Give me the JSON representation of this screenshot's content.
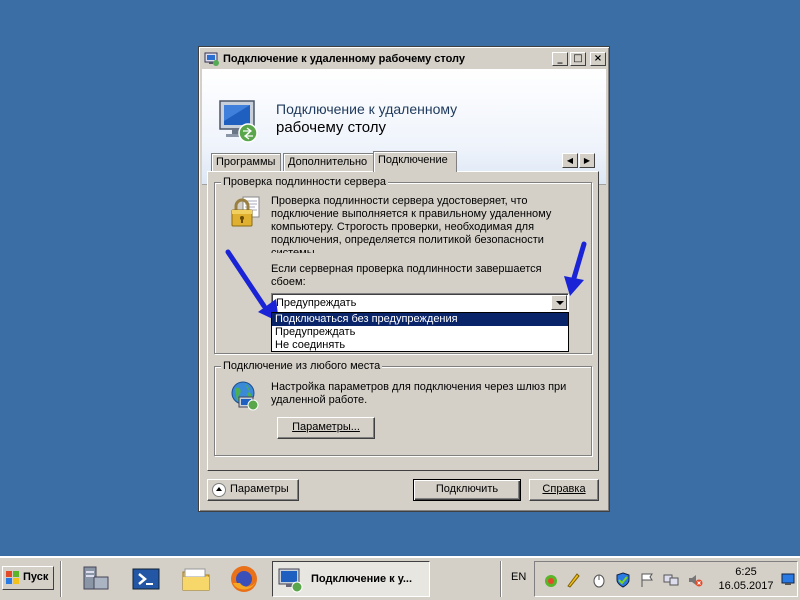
{
  "window": {
    "title": "Подключение к удаленному рабочему столу",
    "header_line1": "Подключение к удаленному",
    "header_line2": "рабочему столу",
    "controls": [
      "_",
      "□",
      "×"
    ]
  },
  "tabs": [
    {
      "label": "Программы",
      "active": false
    },
    {
      "label": "Дополнительно",
      "active": false
    },
    {
      "label": "Подключение",
      "active": true
    }
  ],
  "server_auth": {
    "legend": "Проверка подлинности сервера",
    "description": "Проверка подлинности сервера удостоверяет, что подключение выполняется к правильному удаленному компьютеру. Строгость проверки, необходимая для подключения, определяется политикой безопасности системы.",
    "fail_label": "Если серверная проверка подлинности завершается сбоем:",
    "selected": "Предупреждать",
    "options": [
      {
        "label": "Подключаться без предупреждения",
        "highlighted": true
      },
      {
        "label": "Предупреждать",
        "highlighted": false
      },
      {
        "label": "Не соединять",
        "highlighted": false
      }
    ]
  },
  "anywhere": {
    "legend": "Подключение из любого места",
    "description": "Настройка параметров для подключения через шлюз при удаленной работе.",
    "button": "Параметры..."
  },
  "footer": {
    "options_button": "Параметры",
    "connect_button": "Подключить",
    "help_button": "Справка"
  },
  "taskbar": {
    "start_label": "Пуск",
    "task_label": "Подключение к у...",
    "language": "EN",
    "time": "6:25",
    "date": "16.05.2017"
  }
}
